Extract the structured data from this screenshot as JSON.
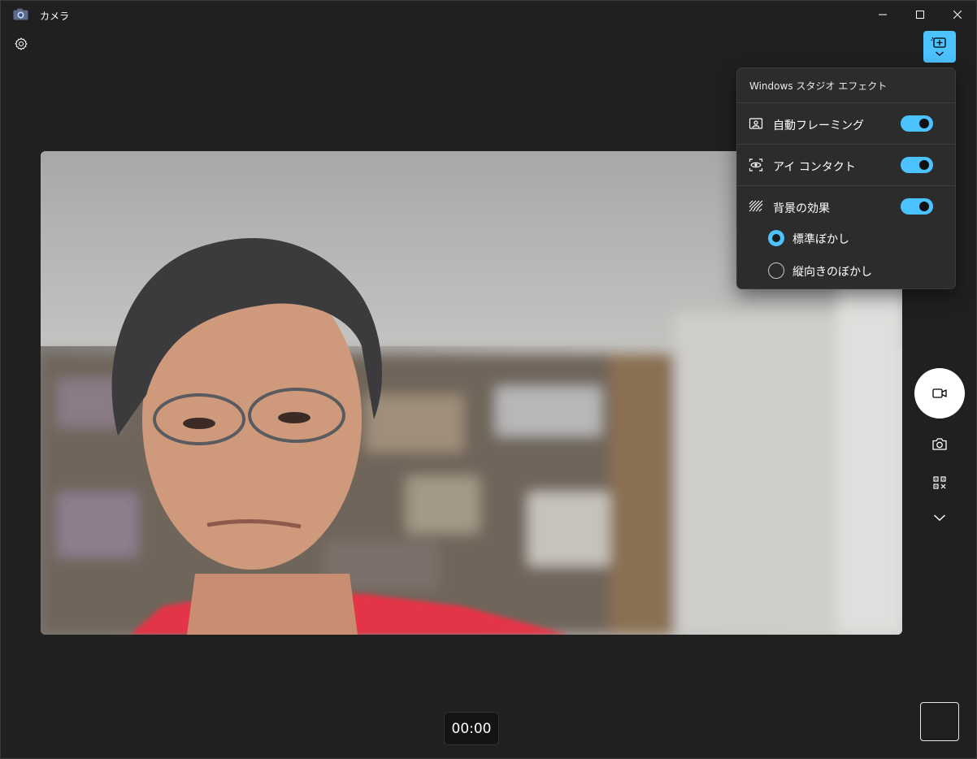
{
  "window": {
    "title": "カメラ",
    "icons": {
      "app": "camera-app-icon",
      "minimize": "minimize-icon",
      "maximize": "maximize-icon",
      "close": "close-icon"
    }
  },
  "toolbar": {
    "settings_icon": "gear-icon",
    "effects_icon": "studio-effects-icon"
  },
  "effects_panel": {
    "title": "Windows スタジオ エフェクト",
    "items": [
      {
        "label": "自動フレーミング",
        "icon": "auto-framing-icon",
        "enabled": true
      },
      {
        "label": "アイ コンタクト",
        "icon": "eye-contact-icon",
        "enabled": true
      },
      {
        "label": "背景の効果",
        "icon": "background-effect-icon",
        "enabled": true
      }
    ],
    "background_options": [
      {
        "label": "標準ぼかし",
        "selected": true
      },
      {
        "label": "縦向きのぼかし",
        "selected": false
      }
    ]
  },
  "capture": {
    "shutter_icon": "video-camera-icon",
    "photo_icon": "photo-camera-icon",
    "qr_icon": "qr-code-icon",
    "more_icon": "chevron-down-icon",
    "timer": "00:00"
  },
  "colors": {
    "accent": "#4cc2ff",
    "background": "#202020",
    "panel": "#2c2c2c"
  }
}
